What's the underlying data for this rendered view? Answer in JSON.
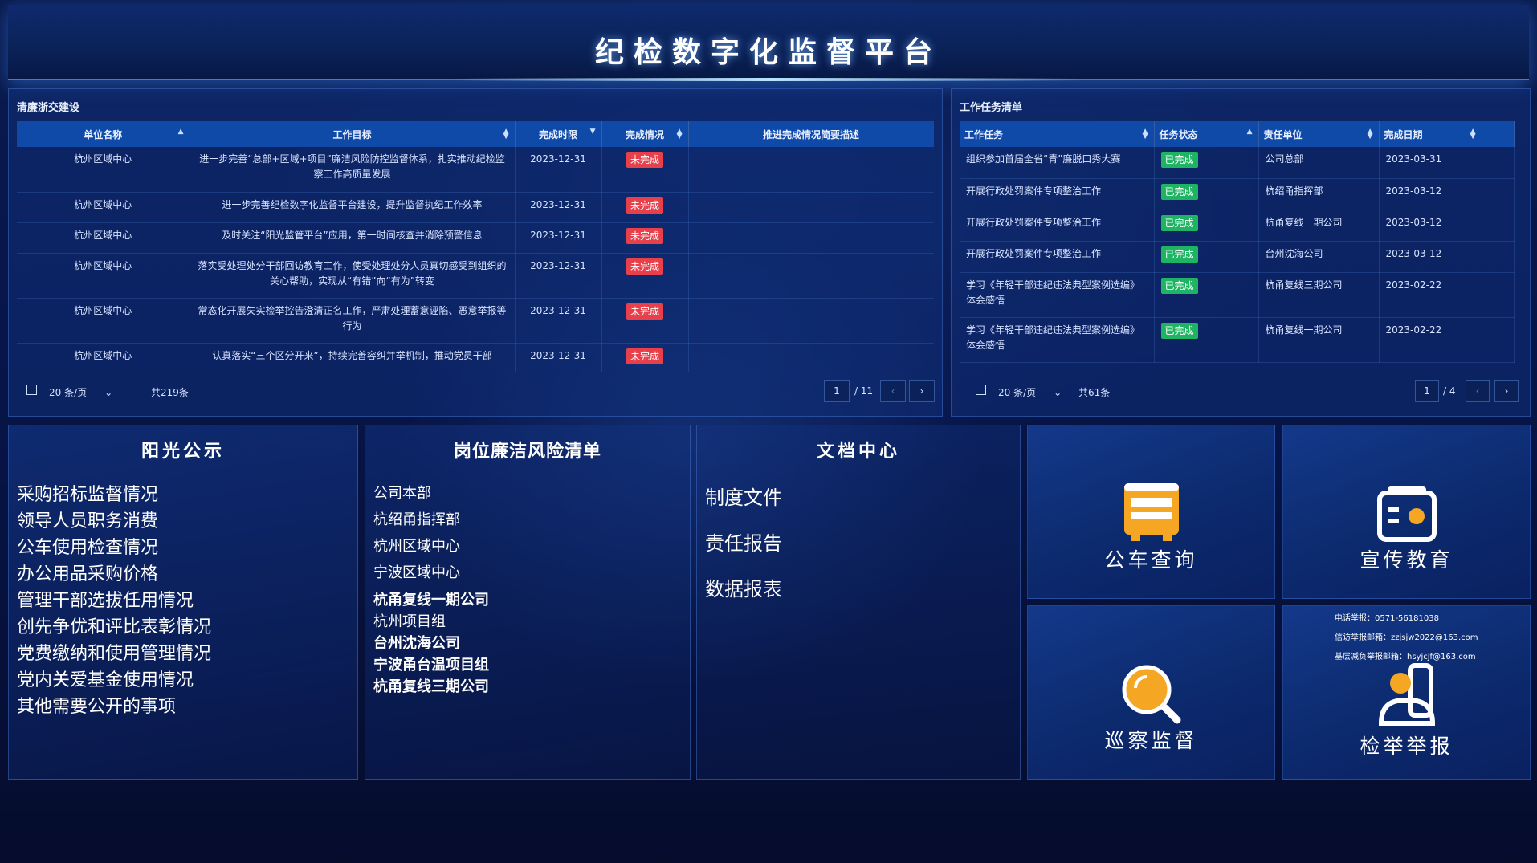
{
  "header": {
    "title": "纪检数字化监督平台"
  },
  "left_panel": {
    "title": "清廉浙交建设",
    "columns": [
      "单位名称",
      "工作目标",
      "完成时限",
      "完成情况",
      "推进完成情况简要描述"
    ],
    "rows": [
      {
        "unit": "杭州区域中心",
        "goal": "进一步完善“总部+区域+项目”廉洁风险防控监督体系，扎实推动纪检监察工作高质量发展",
        "deadline": "2023-12-31",
        "status": "未完成",
        "desc": ""
      },
      {
        "unit": "杭州区域中心",
        "goal": "进一步完善纪检数字化监督平台建设，提升监督执纪工作效率",
        "deadline": "2023-12-31",
        "status": "未完成",
        "desc": ""
      },
      {
        "unit": "杭州区域中心",
        "goal": "及时关注“阳光监管平台”应用，第一时间核查并消除预警信息",
        "deadline": "2023-12-31",
        "status": "未完成",
        "desc": ""
      },
      {
        "unit": "杭州区域中心",
        "goal": "落实受处理处分干部回访教育工作，使受处理处分人员真切感受到组织的关心帮助，实现从“有错”向“有为”转变",
        "deadline": "2023-12-31",
        "status": "未完成",
        "desc": ""
      },
      {
        "unit": "杭州区域中心",
        "goal": "常态化开展失实检举控告澄清正名工作，严肃处理蓄意诬陷、恶意举报等行为",
        "deadline": "2023-12-31",
        "status": "未完成",
        "desc": ""
      },
      {
        "unit": "杭州区域中心",
        "goal": "认真落实“三个区分开来”，持续完善容纠并举机制，推动党员干部",
        "deadline": "2023-12-31",
        "status": "未完成",
        "desc": ""
      }
    ],
    "page_size": "20 条/页",
    "total": "共219条",
    "page_current": "1",
    "page_total": "/ 11"
  },
  "right_panel": {
    "title": "工作任务清单",
    "columns": [
      "工作任务",
      "任务状态",
      "责任单位",
      "完成日期"
    ],
    "rows": [
      {
        "task": "组织参加首届全省“青”廉脱口秀大赛",
        "status": "已完成",
        "unit": "公司总部",
        "date": "2023-03-31"
      },
      {
        "task": "开展行政处罚案件专项整治工作",
        "status": "已完成",
        "unit": "杭绍甬指挥部",
        "date": "2023-03-12"
      },
      {
        "task": "开展行政处罚案件专项整治工作",
        "status": "已完成",
        "unit": "杭甬复线一期公司",
        "date": "2023-03-12"
      },
      {
        "task": "开展行政处罚案件专项整治工作",
        "status": "已完成",
        "unit": "台州沈海公司",
        "date": "2023-03-12"
      },
      {
        "task": "学习《年轻干部违纪违法典型案例选编》体会感悟",
        "status": "已完成",
        "unit": "杭甬复线三期公司",
        "date": "2023-02-22"
      },
      {
        "task": "学习《年轻干部违纪违法典型案例选编》体会感悟",
        "status": "已完成",
        "unit": "杭甬复线一期公司",
        "date": "2023-02-22"
      }
    ],
    "page_size": "20 条/页",
    "total": "共61条",
    "page_current": "1",
    "page_total": "/ 4"
  },
  "sunshine": {
    "title": "阳光公示",
    "items": [
      "采购招标监督情况",
      "领导人员职务消费",
      "公车使用检查情况",
      "办公用品采购价格",
      "管理干部选拔任用情况",
      "创先争优和评比表彰情况",
      "党费缴纳和使用管理情况",
      "党内关爱基金使用情况",
      "其他需要公开的事项"
    ]
  },
  "risk": {
    "title": "岗位廉洁风险清单",
    "items": [
      "公司本部",
      "杭绍甬指挥部",
      "杭州区域中心",
      "宁波区域中心",
      "杭甬复线一期公司",
      "杭州项目组",
      "台州沈海公司",
      "宁波甬台温项目组",
      "杭甬复线三期公司"
    ]
  },
  "docs": {
    "title": "文档中心",
    "items": [
      "制度文件",
      "责任报告",
      "数据报表"
    ]
  },
  "tiles": {
    "car": {
      "label": "公车查询",
      "icon": "bus-icon"
    },
    "edu": {
      "label": "宣传教育",
      "icon": "radio-icon"
    },
    "patrol": {
      "label": "巡察监督",
      "icon": "magnifier-icon"
    },
    "report": {
      "label": "检举举报",
      "icon": "reporter-icon"
    }
  },
  "contacts": {
    "phone": "电话举报：0571-56181038",
    "mail": "信访举报邮箱：zzjsjw2022@163.com",
    "mail2": "基层减负举报邮箱：hsyjcjf@163.com"
  },
  "colors": {
    "accent": "#0f4aa8",
    "danger": "#e8404b",
    "success": "#1fb463",
    "icon": "#f5a623"
  }
}
